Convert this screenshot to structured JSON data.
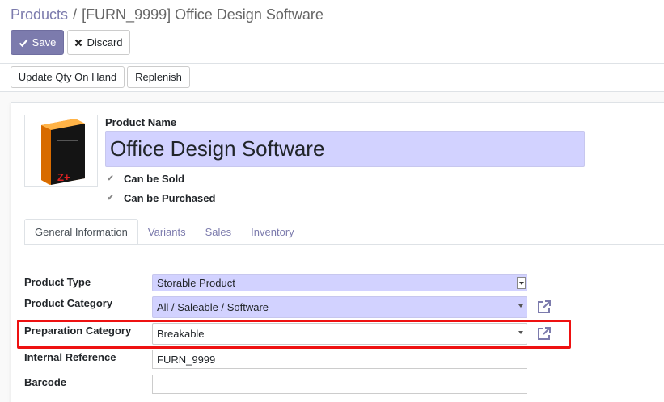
{
  "breadcrumb": {
    "parent": "Products",
    "separator": "/",
    "current": "[FURN_9999] Office Design Software"
  },
  "toolbar": {
    "save_label": "Save",
    "discard_label": "Discard"
  },
  "actions": {
    "update_qty_label": "Update Qty On Hand",
    "replenish_label": "Replenish"
  },
  "product": {
    "name_label": "Product Name",
    "name_value": "Office Design Software",
    "can_be_sold_label": "Can be Sold",
    "can_be_purchased_label": "Can be Purchased",
    "image_text": "Z+"
  },
  "tabs": [
    {
      "label": "General Information",
      "active": true
    },
    {
      "label": "Variants",
      "active": false
    },
    {
      "label": "Sales",
      "active": false
    },
    {
      "label": "Inventory",
      "active": false
    }
  ],
  "fields": {
    "product_type": {
      "label": "Product Type",
      "value": "Storable Product"
    },
    "product_category": {
      "label": "Product Category",
      "value": "All / Saleable / Software"
    },
    "preparation_category": {
      "label": "Preparation Category",
      "value": "Breakable"
    },
    "internal_reference": {
      "label": "Internal Reference",
      "value": "FURN_9999"
    },
    "barcode": {
      "label": "Barcode",
      "value": ""
    }
  },
  "colors": {
    "accent": "#7c7bad",
    "required_field": "#d2d2ff",
    "highlight": "#ee1111"
  },
  "icons": {
    "save": "check-icon",
    "discard": "x-icon",
    "external": "external-link-icon"
  }
}
